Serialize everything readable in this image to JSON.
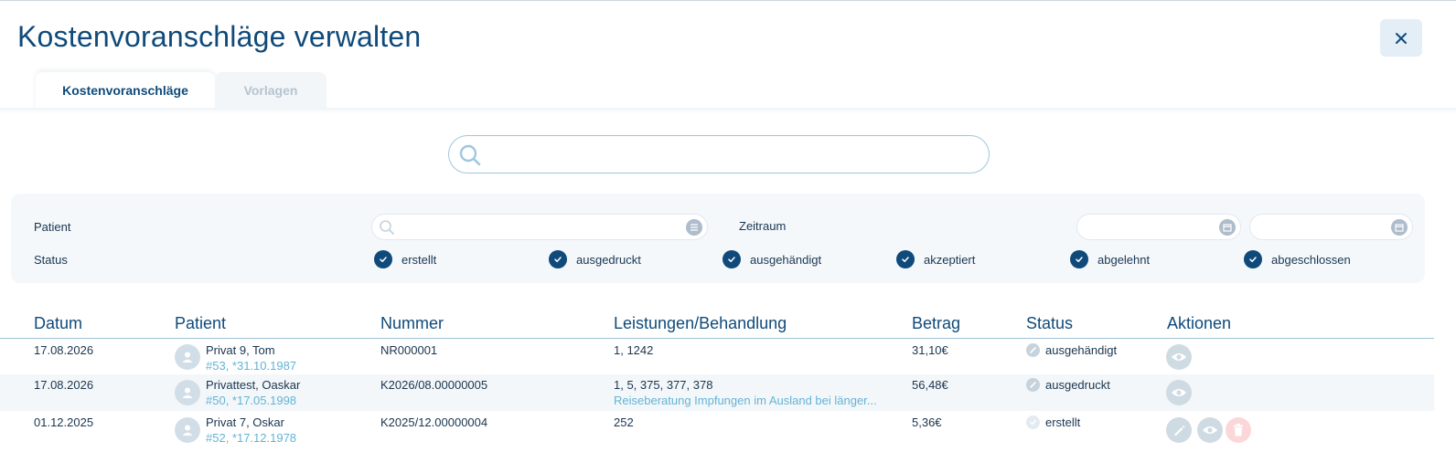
{
  "page": {
    "title": "Kostenvoranschläge verwalten"
  },
  "tabs": [
    {
      "label": "Kostenvoranschläge",
      "active": true
    },
    {
      "label": "Vorlagen",
      "active": false
    }
  ],
  "search": {
    "value": "",
    "placeholder": ""
  },
  "filters": {
    "patient_label": "Patient",
    "patient_value": "",
    "zeitraum_label": "Zeitraum",
    "date_from": "",
    "date_to": "",
    "status_label": "Status",
    "statuses": [
      {
        "label": "erstellt",
        "checked": true
      },
      {
        "label": "ausgedruckt",
        "checked": true
      },
      {
        "label": "ausgehändigt",
        "checked": true
      },
      {
        "label": "akzeptiert",
        "checked": true
      },
      {
        "label": "abgelehnt",
        "checked": true
      },
      {
        "label": "abgeschlossen",
        "checked": true
      }
    ]
  },
  "table": {
    "columns": [
      "Datum",
      "Patient",
      "Nummer",
      "Leistungen/Behandlung",
      "Betrag",
      "Status",
      "Aktionen"
    ],
    "rows": [
      {
        "datum": "17.08.2026",
        "patient_name": "Privat 9, Tom",
        "patient_sub": "#53, *31.10.1987",
        "nummer": "NR000001",
        "leistungen": "1, 1242",
        "leistungen_sub": "",
        "betrag": "31,10€",
        "status": "ausgehändigt",
        "actions": [
          "view"
        ]
      },
      {
        "datum": "17.08.2026",
        "patient_name": "Privattest, Oaskar",
        "patient_sub": "#50, *17.05.1998",
        "nummer": "K2026/08.00000005",
        "leistungen": "1, 5, 375, 377, 378",
        "leistungen_sub": "Reiseberatung Impfungen im Ausland bei länger...",
        "betrag": "56,48€",
        "status": "ausgedruckt",
        "actions": [
          "view"
        ]
      },
      {
        "datum": "01.12.2025",
        "patient_name": "Privat 7, Oskar",
        "patient_sub": "#52, *17.12.1978",
        "nummer": "K2025/12.00000004",
        "leistungen": "252",
        "leistungen_sub": "",
        "betrag": "5,36€",
        "status": "erstellt",
        "actions": [
          "edit",
          "view",
          "delete"
        ]
      }
    ]
  },
  "colors": {
    "primary": "#0f4a7a",
    "accent": "#63b3d6",
    "danger_soft": "#fbd7d9",
    "icon_grey": "#cfdbe3"
  }
}
